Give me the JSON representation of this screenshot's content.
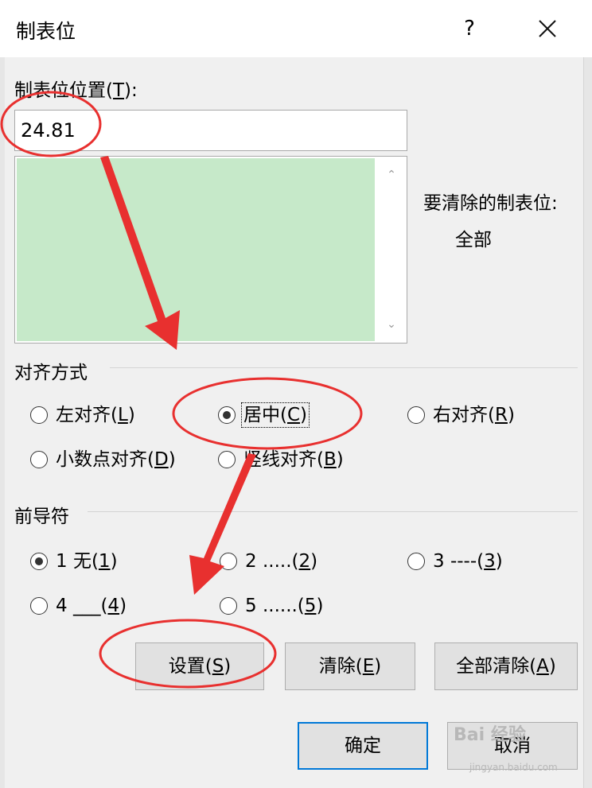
{
  "dialog": {
    "title": "制表位",
    "help": "?"
  },
  "tab_position": {
    "label_prefix": "制表位位置(",
    "label_key": "T",
    "label_suffix": "):",
    "value": "24.81"
  },
  "clear_list": {
    "label": "要清除的制表位:",
    "value": "全部"
  },
  "alignment": {
    "label": "对齐方式",
    "options": [
      {
        "text": "左对齐(",
        "key": "L",
        "end": ")",
        "selected": false
      },
      {
        "text": "居中(",
        "key": "C",
        "end": ")",
        "selected": true
      },
      {
        "text": "右对齐(",
        "key": "R",
        "end": ")",
        "selected": false
      },
      {
        "text": "小数点对齐(",
        "key": "D",
        "end": ")",
        "selected": false
      },
      {
        "text": "竖线对齐(",
        "key": "B",
        "end": ")",
        "selected": false
      }
    ]
  },
  "leader": {
    "label": "前导符",
    "options": [
      {
        "text": "1 无(",
        "key": "1",
        "end": ")",
        "selected": true
      },
      {
        "text": "2 .....(",
        "key": "2",
        "end": ")",
        "selected": false
      },
      {
        "text": "3 ----(",
        "key": "3",
        "end": ")",
        "selected": false
      },
      {
        "text": "4 ___(",
        "key": "4",
        "end": ")",
        "selected": false
      },
      {
        "text": "5 ......(",
        "key": "5",
        "end": ")",
        "selected": false
      }
    ]
  },
  "buttons": {
    "set": {
      "text": "设置(",
      "key": "S",
      "end": ")"
    },
    "clear": {
      "text": "清除(",
      "key": "E",
      "end": ")"
    },
    "clear_all": {
      "text": "全部清除(",
      "key": "A",
      "end": ")"
    },
    "ok": "确定",
    "cancel": "取消"
  },
  "watermark": {
    "brand": "Bai 经验",
    "url": "jingyan.baidu.com"
  },
  "colors": {
    "list_fill": "#c6e9c9",
    "annotation": "#e8302f",
    "default_border": "#0078d7"
  },
  "icons": {
    "close": "close-icon",
    "scroll_up": "chevron-up-icon",
    "scroll_down": "chevron-down-icon"
  }
}
